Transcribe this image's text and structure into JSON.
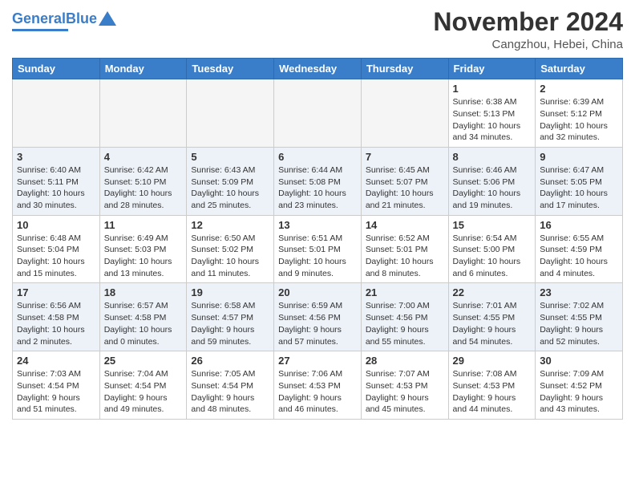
{
  "logo": {
    "line1": "General",
    "line2": "Blue"
  },
  "title": "November 2024",
  "location": "Cangzhou, Hebei, China",
  "weekdays": [
    "Sunday",
    "Monday",
    "Tuesday",
    "Wednesday",
    "Thursday",
    "Friday",
    "Saturday"
  ],
  "weeks": [
    [
      {
        "day": "",
        "info": ""
      },
      {
        "day": "",
        "info": ""
      },
      {
        "day": "",
        "info": ""
      },
      {
        "day": "",
        "info": ""
      },
      {
        "day": "",
        "info": ""
      },
      {
        "day": "1",
        "info": "Sunrise: 6:38 AM\nSunset: 5:13 PM\nDaylight: 10 hours\nand 34 minutes."
      },
      {
        "day": "2",
        "info": "Sunrise: 6:39 AM\nSunset: 5:12 PM\nDaylight: 10 hours\nand 32 minutes."
      }
    ],
    [
      {
        "day": "3",
        "info": "Sunrise: 6:40 AM\nSunset: 5:11 PM\nDaylight: 10 hours\nand 30 minutes."
      },
      {
        "day": "4",
        "info": "Sunrise: 6:42 AM\nSunset: 5:10 PM\nDaylight: 10 hours\nand 28 minutes."
      },
      {
        "day": "5",
        "info": "Sunrise: 6:43 AM\nSunset: 5:09 PM\nDaylight: 10 hours\nand 25 minutes."
      },
      {
        "day": "6",
        "info": "Sunrise: 6:44 AM\nSunset: 5:08 PM\nDaylight: 10 hours\nand 23 minutes."
      },
      {
        "day": "7",
        "info": "Sunrise: 6:45 AM\nSunset: 5:07 PM\nDaylight: 10 hours\nand 21 minutes."
      },
      {
        "day": "8",
        "info": "Sunrise: 6:46 AM\nSunset: 5:06 PM\nDaylight: 10 hours\nand 19 minutes."
      },
      {
        "day": "9",
        "info": "Sunrise: 6:47 AM\nSunset: 5:05 PM\nDaylight: 10 hours\nand 17 minutes."
      }
    ],
    [
      {
        "day": "10",
        "info": "Sunrise: 6:48 AM\nSunset: 5:04 PM\nDaylight: 10 hours\nand 15 minutes."
      },
      {
        "day": "11",
        "info": "Sunrise: 6:49 AM\nSunset: 5:03 PM\nDaylight: 10 hours\nand 13 minutes."
      },
      {
        "day": "12",
        "info": "Sunrise: 6:50 AM\nSunset: 5:02 PM\nDaylight: 10 hours\nand 11 minutes."
      },
      {
        "day": "13",
        "info": "Sunrise: 6:51 AM\nSunset: 5:01 PM\nDaylight: 10 hours\nand 9 minutes."
      },
      {
        "day": "14",
        "info": "Sunrise: 6:52 AM\nSunset: 5:01 PM\nDaylight: 10 hours\nand 8 minutes."
      },
      {
        "day": "15",
        "info": "Sunrise: 6:54 AM\nSunset: 5:00 PM\nDaylight: 10 hours\nand 6 minutes."
      },
      {
        "day": "16",
        "info": "Sunrise: 6:55 AM\nSunset: 4:59 PM\nDaylight: 10 hours\nand 4 minutes."
      }
    ],
    [
      {
        "day": "17",
        "info": "Sunrise: 6:56 AM\nSunset: 4:58 PM\nDaylight: 10 hours\nand 2 minutes."
      },
      {
        "day": "18",
        "info": "Sunrise: 6:57 AM\nSunset: 4:58 PM\nDaylight: 10 hours\nand 0 minutes."
      },
      {
        "day": "19",
        "info": "Sunrise: 6:58 AM\nSunset: 4:57 PM\nDaylight: 9 hours\nand 59 minutes."
      },
      {
        "day": "20",
        "info": "Sunrise: 6:59 AM\nSunset: 4:56 PM\nDaylight: 9 hours\nand 57 minutes."
      },
      {
        "day": "21",
        "info": "Sunrise: 7:00 AM\nSunset: 4:56 PM\nDaylight: 9 hours\nand 55 minutes."
      },
      {
        "day": "22",
        "info": "Sunrise: 7:01 AM\nSunset: 4:55 PM\nDaylight: 9 hours\nand 54 minutes."
      },
      {
        "day": "23",
        "info": "Sunrise: 7:02 AM\nSunset: 4:55 PM\nDaylight: 9 hours\nand 52 minutes."
      }
    ],
    [
      {
        "day": "24",
        "info": "Sunrise: 7:03 AM\nSunset: 4:54 PM\nDaylight: 9 hours\nand 51 minutes."
      },
      {
        "day": "25",
        "info": "Sunrise: 7:04 AM\nSunset: 4:54 PM\nDaylight: 9 hours\nand 49 minutes."
      },
      {
        "day": "26",
        "info": "Sunrise: 7:05 AM\nSunset: 4:54 PM\nDaylight: 9 hours\nand 48 minutes."
      },
      {
        "day": "27",
        "info": "Sunrise: 7:06 AM\nSunset: 4:53 PM\nDaylight: 9 hours\nand 46 minutes."
      },
      {
        "day": "28",
        "info": "Sunrise: 7:07 AM\nSunset: 4:53 PM\nDaylight: 9 hours\nand 45 minutes."
      },
      {
        "day": "29",
        "info": "Sunrise: 7:08 AM\nSunset: 4:53 PM\nDaylight: 9 hours\nand 44 minutes."
      },
      {
        "day": "30",
        "info": "Sunrise: 7:09 AM\nSunset: 4:52 PM\nDaylight: 9 hours\nand 43 minutes."
      }
    ]
  ]
}
